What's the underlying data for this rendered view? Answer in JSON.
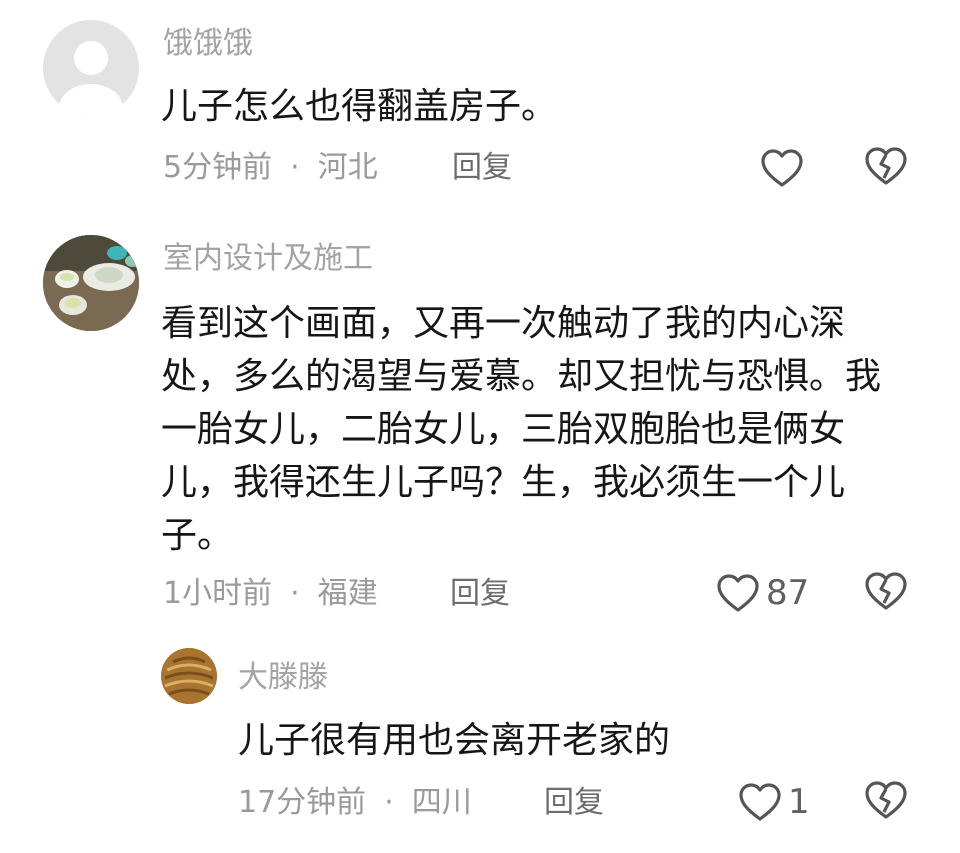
{
  "comments": [
    {
      "username": "饿饿饿",
      "text": "儿子怎么也得翻盖房子。",
      "time": "5分钟前",
      "separator": "·",
      "location": "河北",
      "reply_label": "回复",
      "like_count": "",
      "avatar": "default-person-avatar"
    },
    {
      "username": "室内设计及施工",
      "text": "看到这个画面，又再一次触动了我的内心深处，多么的渴望与爱慕。却又担忧与恐惧。我一胎女儿，二胎女儿，三胎双胞胎也是俩女儿，我得还生儿子吗？生，我必须生一个儿子。",
      "time": "1小时前",
      "separator": "·",
      "location": "福建",
      "reply_label": "回复",
      "like_count": "87",
      "avatar": "tea-cups-avatar"
    }
  ],
  "reply": {
    "username": "大滕滕",
    "text": "儿子很有用也会离开老家的",
    "time": "17分钟前",
    "separator": "·",
    "location": "四川",
    "reply_label": "回复",
    "like_count": "1",
    "avatar": "woven-basket-avatar"
  },
  "colors": {
    "username": "#a3a3a3",
    "text": "#161616",
    "meta": "#9a9a9a",
    "icon_stroke": "#555555"
  }
}
